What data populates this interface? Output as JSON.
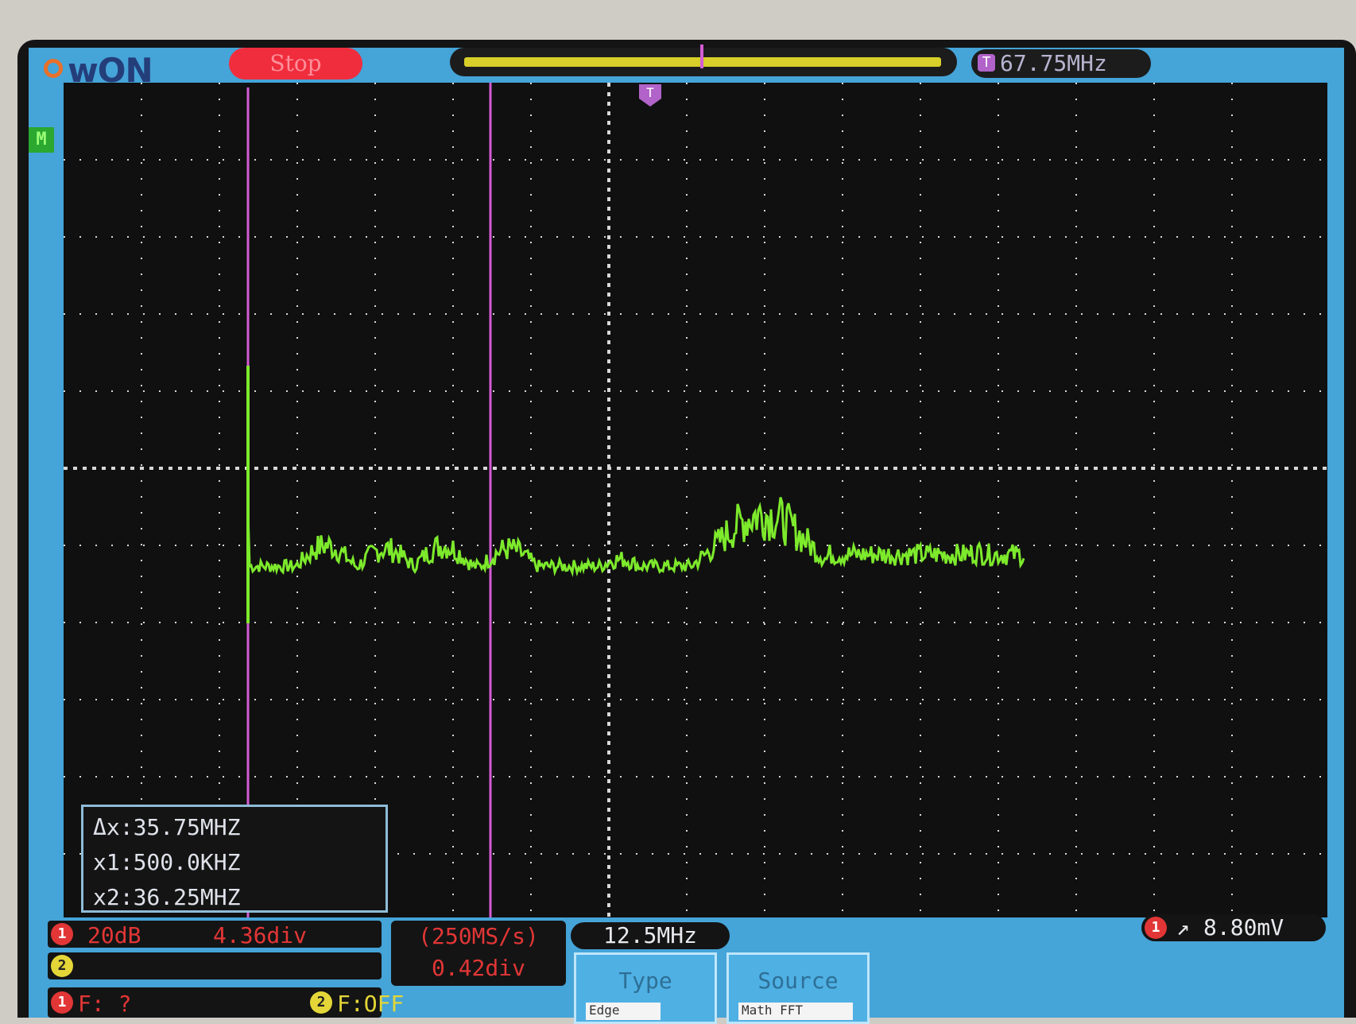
{
  "brand": {
    "logo_text": "wON"
  },
  "status": {
    "run_state": "Stop"
  },
  "trigger": {
    "freq": "67.75MHz",
    "marker": "T",
    "level": "8.80mV"
  },
  "grid": {
    "cols": 15,
    "rows": 10
  },
  "side_marker": "M",
  "cursors": {
    "delta": "Δx:35.75MHZ",
    "x1": "x1:500.0KHZ",
    "x2": "x2:36.25MHZ"
  },
  "channels": {
    "ch1": {
      "badge": "1",
      "gain": "20dB",
      "offset": "4.36div"
    },
    "ch2": {
      "badge": "2"
    },
    "fft": {
      "ch1_badge": "1",
      "ch1_label": "F:  ?",
      "ch2_badge": "2",
      "ch2_label": "F:OFF"
    }
  },
  "acquisition": {
    "sample_rate": "(250MS/s)",
    "position": "0.42div"
  },
  "horizontal": {
    "scale": "12.5MHz"
  },
  "softkeys": [
    {
      "label": "Type",
      "value": "Edge"
    },
    {
      "label": "Source",
      "value": "Math FFT"
    }
  ],
  "colors": {
    "trace": "#7dea2c",
    "cursor": "#d45cd6",
    "screen_frame": "#45a4d8",
    "ch1": "#e23636",
    "ch2": "#e4d638"
  }
}
